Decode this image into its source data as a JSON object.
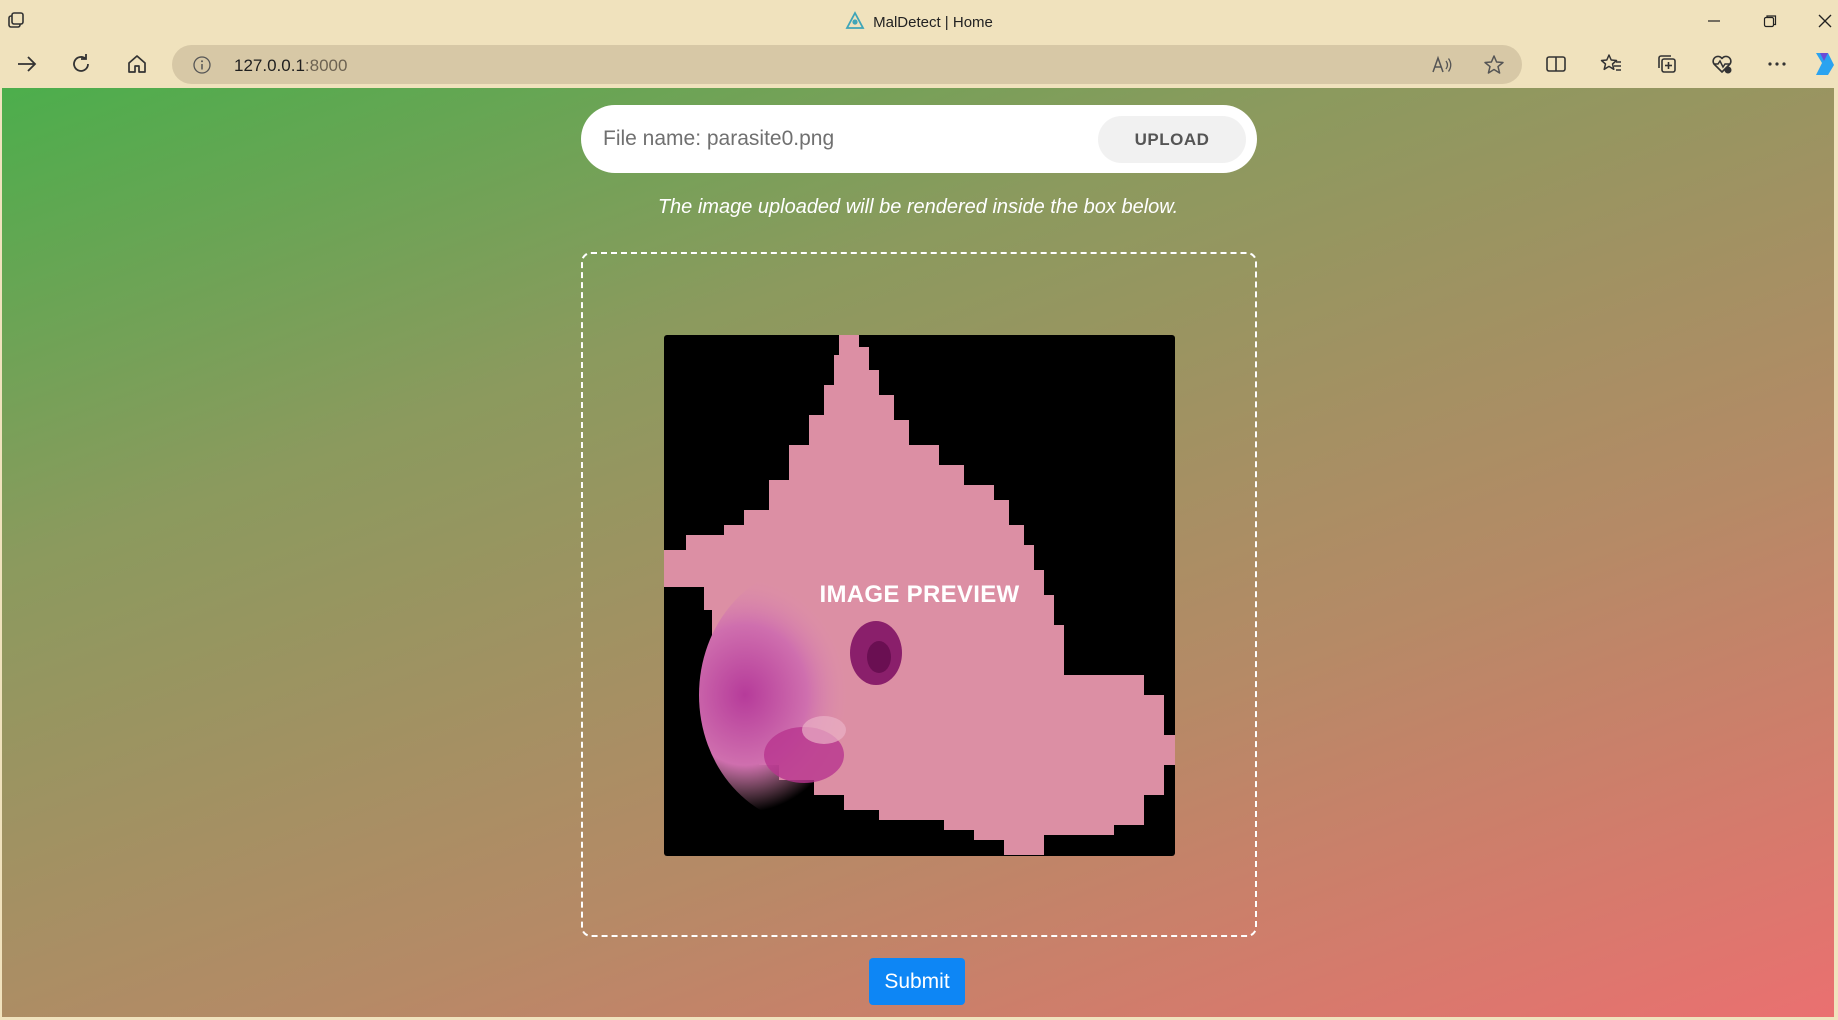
{
  "window": {
    "title": "MalDetect | Home",
    "favicon": "triangle-logo-icon",
    "controls": [
      "minimize-icon",
      "restore-icon",
      "close-icon"
    ]
  },
  "toolbar": {
    "url_host": "127.0.0.1",
    "url_port": ":8000",
    "left_buttons": [
      "forward-icon",
      "refresh-icon",
      "home-icon"
    ],
    "right_buttons": [
      "split-screen-icon",
      "favorites-icon",
      "collections-icon",
      "performance-icon",
      "more-icon",
      "copilot-icon"
    ]
  },
  "page": {
    "file_name": "File name: parasite0.png",
    "upload_label": "UPLOAD",
    "hint": "The image uploaded will be rendered inside the box below.",
    "preview_label": "IMAGE PREVIEW",
    "submit_label": "Submit"
  },
  "colors": {
    "gradient_start": "#4cae4c",
    "gradient_end": "#ea7070",
    "submit_bg": "#0d86f5"
  }
}
